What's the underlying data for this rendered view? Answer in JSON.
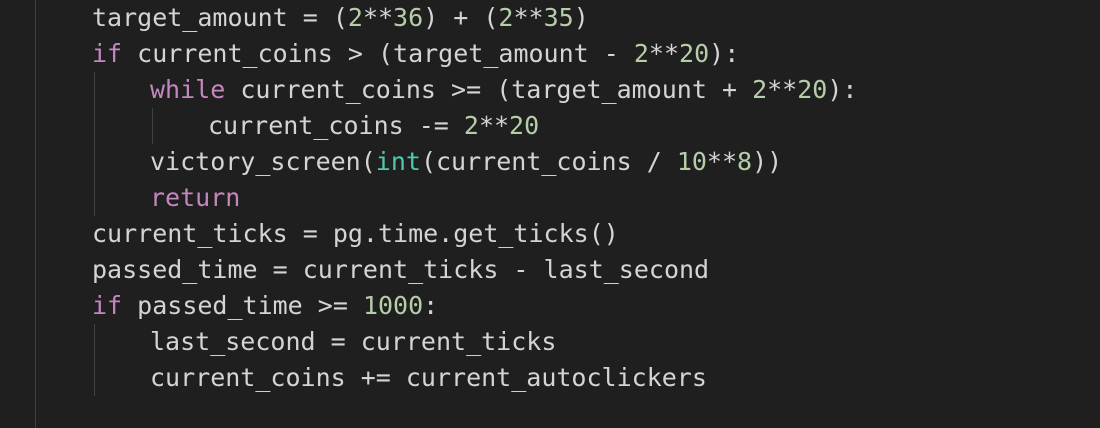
{
  "editor": {
    "language": "python",
    "colors": {
      "background": "#1f1f1f",
      "text": "#d4d4d4",
      "keyword": "#c586c0",
      "number": "#b5cea8",
      "builtin": "#4ec9b0",
      "indent_guide": "#404040"
    },
    "lines": [
      {
        "tokens": [
          "target_amount = (",
          "2",
          "**",
          "36",
          ") + (",
          "2",
          "**",
          "35",
          ")"
        ]
      },
      {
        "tokens": [
          "if",
          " current_coins > (target_amount - ",
          "2",
          "**",
          "20",
          "):"
        ]
      },
      {
        "tokens": [
          "while",
          " current_coins >= (target_amount + ",
          "2",
          "**",
          "20",
          "):"
        ]
      },
      {
        "tokens": [
          "current_coins -= ",
          "2",
          "**",
          "20"
        ]
      },
      {
        "tokens": [
          "victory_screen(",
          "int",
          "(current_coins / ",
          "10",
          "**",
          "8",
          "))"
        ]
      },
      {
        "tokens": [
          "return"
        ]
      },
      {
        "tokens": [
          "current_ticks = pg.time.get_ticks()"
        ]
      },
      {
        "tokens": [
          "passed_time = current_ticks - last_second"
        ]
      },
      {
        "tokens": [
          "if",
          " passed_time >= ",
          "1000",
          ":"
        ]
      },
      {
        "tokens": [
          "last_second = current_ticks"
        ]
      },
      {
        "tokens": [
          "current_coins += current_autoclickers"
        ]
      }
    ]
  }
}
